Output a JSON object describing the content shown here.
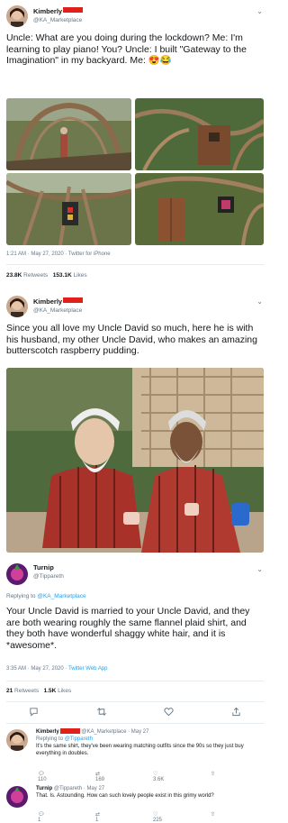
{
  "tweet1": {
    "display_name": "Kimberly",
    "handle": "@KA_Marketplace",
    "text": "Uncle: What are you doing during the lockdown? Me: I'm learning to play piano! You? Uncle: I built \"Gateway to the Imagination\" in my backyard. Me: 😍😂",
    "timestamp": "1:21 AM · May 27, 2020 · Twitter for iPhone",
    "retweets": "23.8K",
    "retweets_label": "Retweets",
    "likes": "153.1K",
    "likes_label": "Likes"
  },
  "tweet2": {
    "display_name": "Kimberly",
    "handle": "@KA_Marketplace",
    "text": "Since you all love my Uncle David so much, here he is with his husband, my other Uncle David, who makes an amazing butterscotch raspberry pudding."
  },
  "tweet3": {
    "display_name": "Turnip",
    "handle": "@Tippareth",
    "replying_prefix": "Replying to",
    "replying_to": "@KA_Marketplace",
    "text": "Your Uncle David is married to your Uncle David, and they are both wearing roughly the same flannel plaid shirt, and they both have wonderful shaggy white hair, and it is *awesome*.",
    "timestamp": "3:35 AM · May 27, 2020 · ",
    "source": "Twitter Web App",
    "retweets": "21",
    "retweets_label": "Retweets",
    "likes": "1.5K",
    "likes_label": "Likes"
  },
  "reply1": {
    "display_name": "Kimberly",
    "handle_date": "@KA_Marketplace · May 27",
    "replying_prefix": "Replying to",
    "replying_to": "@Tippareth",
    "text": "It's the same shirt, they've been wearing matching outfits since the 90s so they just buy everything in doubles.",
    "replies": "110",
    "retweets": "169",
    "likes": "3.6K"
  },
  "reply2": {
    "display_name": "Turnip",
    "handle_date": "@Tippareth · May 27",
    "text": "That. Is. Astounding. How can such lovely people exist in this grimy world?",
    "replies": "1",
    "retweets": "1",
    "likes": "225"
  },
  "colors": {
    "accent": "#1da1f2",
    "redaction": "#e0211b",
    "muted": "#657786"
  },
  "icons": [
    "chevron-down-icon",
    "reply-icon",
    "retweet-icon",
    "like-icon",
    "share-icon"
  ]
}
